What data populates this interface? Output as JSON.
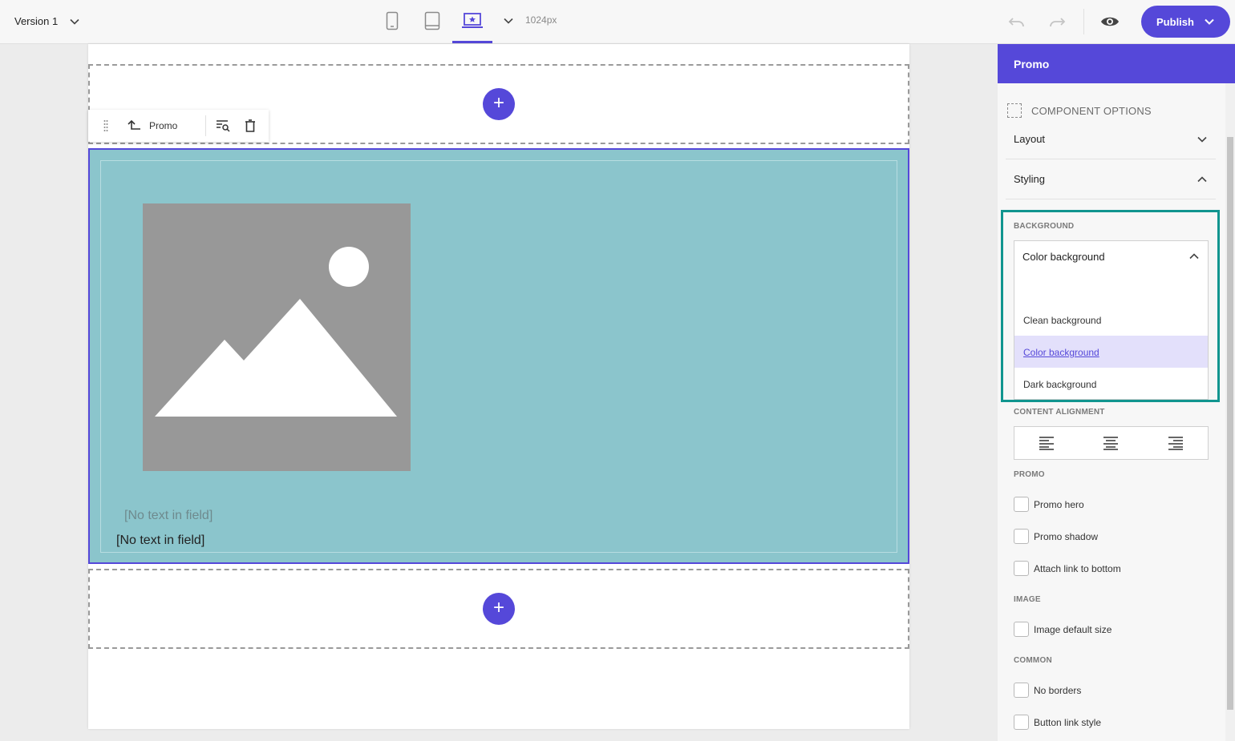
{
  "topbar": {
    "version_label": "Version 1",
    "device_icons": [
      "phone-icon",
      "tablet-icon",
      "desktop-icon"
    ],
    "active_device": "desktop",
    "width_label": "1024px",
    "publish_label": "Publish"
  },
  "canvas": {
    "toolbar": {
      "component_name": "Promo"
    },
    "promo": {
      "text_field_1": "[No text in field]",
      "text_field_2": "[No text in field]"
    },
    "add_button_symbol": "+"
  },
  "panel": {
    "title": "Promo",
    "component_options_label": "COMPONENT OPTIONS",
    "accordions": {
      "layout": "Layout",
      "styling": "Styling"
    },
    "background": {
      "section_label": "BACKGROUND",
      "selected": "Color background",
      "options": [
        "Clean background",
        "Color background",
        "Dark background"
      ]
    },
    "content_alignment_label": "CONTENT ALIGNMENT",
    "promo_section": {
      "label": "PROMO",
      "checkboxes": [
        "Promo hero",
        "Promo shadow",
        "Attach link to bottom"
      ]
    },
    "image_section": {
      "label": "IMAGE",
      "checkboxes": [
        "Image default size"
      ]
    },
    "common_section": {
      "label": "COMMON",
      "checkboxes": [
        "No borders",
        "Button link style"
      ]
    }
  },
  "colors": {
    "accent": "#5548d9",
    "promo_background": "#8bc5cc",
    "highlight_frame": "#11958f",
    "image_placeholder": "#989898"
  }
}
